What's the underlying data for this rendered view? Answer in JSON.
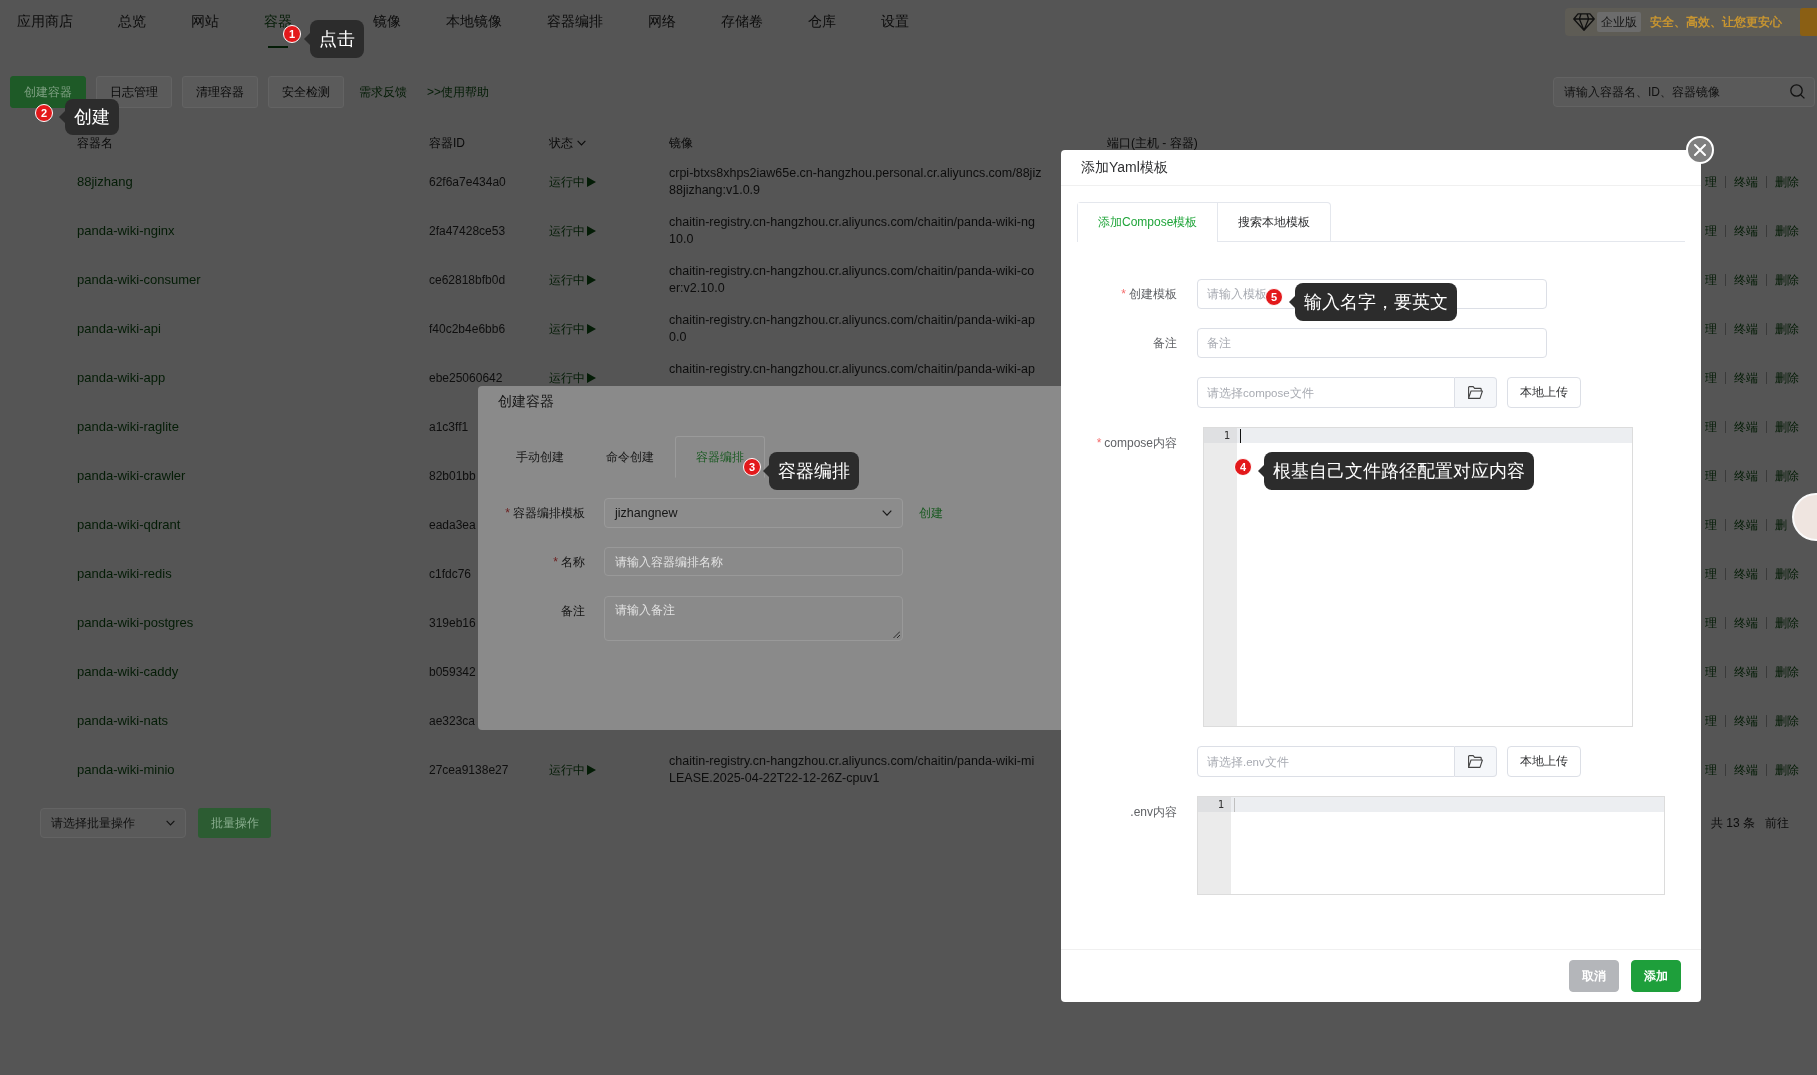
{
  "top_nav": {
    "items": [
      {
        "label": "应用商店",
        "selected": false
      },
      {
        "label": "总览",
        "selected": false
      },
      {
        "label": "网站",
        "selected": false
      },
      {
        "label": "容器",
        "selected": true
      },
      {
        "label": "镜像",
        "selected": false
      },
      {
        "label": "本地镜像",
        "selected": false
      },
      {
        "label": "容器编排",
        "selected": false
      },
      {
        "label": "网络",
        "selected": false
      },
      {
        "label": "存储卷",
        "selected": false
      },
      {
        "label": "仓库",
        "selected": false
      },
      {
        "label": "设置",
        "selected": false
      }
    ],
    "edition": "企业版",
    "slogan": "安全、高效、让您更安心"
  },
  "toolbar": {
    "buttons": [
      {
        "label": "创建容器",
        "kind": "primary"
      },
      {
        "label": "日志管理",
        "kind": "default"
      },
      {
        "label": "清理容器",
        "kind": "default"
      },
      {
        "label": "安全检测",
        "kind": "default"
      },
      {
        "label": "需求反馈",
        "kind": "link"
      },
      {
        "label": ">>使用帮助",
        "kind": "link"
      }
    ],
    "search": {
      "placeholder": "请输入容器名、ID、容器镜像"
    }
  },
  "table": {
    "columns": [
      {
        "label": "容器名",
        "filterable": false
      },
      {
        "label": "容器ID",
        "filterable": false
      },
      {
        "label": "状态",
        "filterable": true
      },
      {
        "label": "镜像",
        "filterable": false
      },
      {
        "label": "端口(主机 - 容器)",
        "filterable": false
      }
    ],
    "rows": [
      {
        "name": "88jizhang",
        "id": "62f6a7e434a0",
        "status": "运行中",
        "image": [
          "crpi-btxs8xhps2iaw65e.cn-hangzhou.personal.cr.aliyuncs.com/88jiz",
          "88jizhang:v1.0.9"
        ],
        "actions": [
          "理",
          "终端",
          "删除"
        ]
      },
      {
        "name": "panda-wiki-nginx",
        "id": "2fa47428ce53",
        "status": "运行中",
        "image": [
          "chaitin-registry.cn-hangzhou.cr.aliyuncs.com/chaitin/panda-wiki-ng",
          "10.0"
        ],
        "actions": [
          "理",
          "终端",
          "删除"
        ]
      },
      {
        "name": "panda-wiki-consumer",
        "id": "ce62818bfb0d",
        "status": "运行中",
        "image": [
          "chaitin-registry.cn-hangzhou.cr.aliyuncs.com/chaitin/panda-wiki-co",
          "er:v2.10.0"
        ],
        "actions": [
          "理",
          "终端",
          "删除"
        ]
      },
      {
        "name": "panda-wiki-api",
        "id": "f40c2b4e6bb6",
        "status": "运行中",
        "image": [
          "chaitin-registry.cn-hangzhou.cr.aliyuncs.com/chaitin/panda-wiki-ap",
          "0.0"
        ],
        "actions": [
          "理",
          "终端",
          "删除"
        ]
      },
      {
        "name": "panda-wiki-app",
        "id": "ebe25060642",
        "status": "运行中",
        "image": [
          "chaitin-registry.cn-hangzhou.cr.aliyuncs.com/chaitin/panda-wiki-ap"
        ],
        "actions": [
          "理",
          "终端",
          "删除"
        ]
      },
      {
        "name": "panda-wiki-raglite",
        "id": "a1c3ff1",
        "actions": [
          "理",
          "终端",
          "删除"
        ]
      },
      {
        "name": "panda-wiki-crawler",
        "id": "82b01bb",
        "actions": [
          "理",
          "终端",
          "删除"
        ]
      },
      {
        "name": "panda-wiki-qdrant",
        "id": "eada3ea",
        "actions": [
          "理",
          "终端",
          "删"
        ]
      },
      {
        "name": "panda-wiki-redis",
        "id": "c1fdc76",
        "actions": [
          "理",
          "终端",
          "删除"
        ]
      },
      {
        "name": "panda-wiki-postgres",
        "id": "319eb16",
        "actions": [
          "理",
          "终端",
          "删除"
        ]
      },
      {
        "name": "panda-wiki-caddy",
        "id": "b059342",
        "actions": [
          "理",
          "终端",
          "删除"
        ]
      },
      {
        "name": "panda-wiki-nats",
        "id": "ae323ca",
        "actions": [
          "理",
          "终端",
          "删除"
        ]
      },
      {
        "name": "panda-wiki-minio",
        "id": "27cea9138e27",
        "status": "运行中",
        "image": [
          "chaitin-registry.cn-hangzhou.cr.aliyuncs.com/chaitin/panda-wiki-mi",
          "LEASE.2025-04-22T22-12-26Z-cpuv1"
        ],
        "actions": [
          "理",
          "终端",
          "删除"
        ]
      }
    ]
  },
  "footer": {
    "batch_select": {
      "placeholder": "请选择批量操作"
    },
    "batch_button": "批量操作",
    "total": "共 13 条",
    "goto": "前往"
  },
  "create_dialog": {
    "title": "创建容器",
    "tabs": [
      {
        "label": "手动创建",
        "selected": false
      },
      {
        "label": "命令创建",
        "selected": false
      },
      {
        "label": "容器编排",
        "selected": true
      }
    ],
    "form": [
      {
        "kind": "select",
        "mark": "*",
        "label": "容器编排模板",
        "value": "jizhangnew",
        "link": "创建"
      },
      {
        "kind": "text",
        "mark": "*",
        "label": "名称",
        "placeholder": "请输入容器编排名称"
      },
      {
        "kind": "textarea",
        "label": "备注",
        "placeholder": "请输入备注"
      }
    ]
  },
  "yaml_dialog": {
    "title": "添加Yaml模板",
    "tabs": [
      {
        "label": "添加Compose模板",
        "selected": true
      },
      {
        "label": "搜索本地模板",
        "selected": false
      }
    ],
    "form": [
      {
        "kind": "text",
        "mark": "*",
        "label": "创建模板",
        "placeholder": "请输入模板"
      },
      {
        "kind": "text",
        "label": "备注",
        "placeholder": "备注"
      },
      {
        "kind": "file",
        "placeholder": "请选择compose文件",
        "button": "本地上传"
      },
      {
        "kind": "editor",
        "mark": "*",
        "label": "compose内容",
        "line_numbers": [
          "1"
        ],
        "focused": true
      },
      {
        "kind": "file",
        "placeholder": "请选择.env文件",
        "button": "本地上传"
      },
      {
        "kind": "editor",
        "label": ".env内容",
        "line_numbers": [
          "1"
        ],
        "focused": false
      }
    ],
    "buttons": [
      {
        "label": "取消",
        "kind": "cancel",
        "disabled": true
      },
      {
        "label": "添加",
        "kind": "primary",
        "disabled": false
      }
    ]
  },
  "annotations": [
    {
      "number": "1",
      "text": "点击"
    },
    {
      "number": "2",
      "text": "创建"
    },
    {
      "number": "5",
      "text": "输入名字，要英文"
    },
    {
      "number": "3",
      "text": "容器编排"
    },
    {
      "number": "4",
      "text": "根基自己文件路径配置对应内容"
    }
  ]
}
